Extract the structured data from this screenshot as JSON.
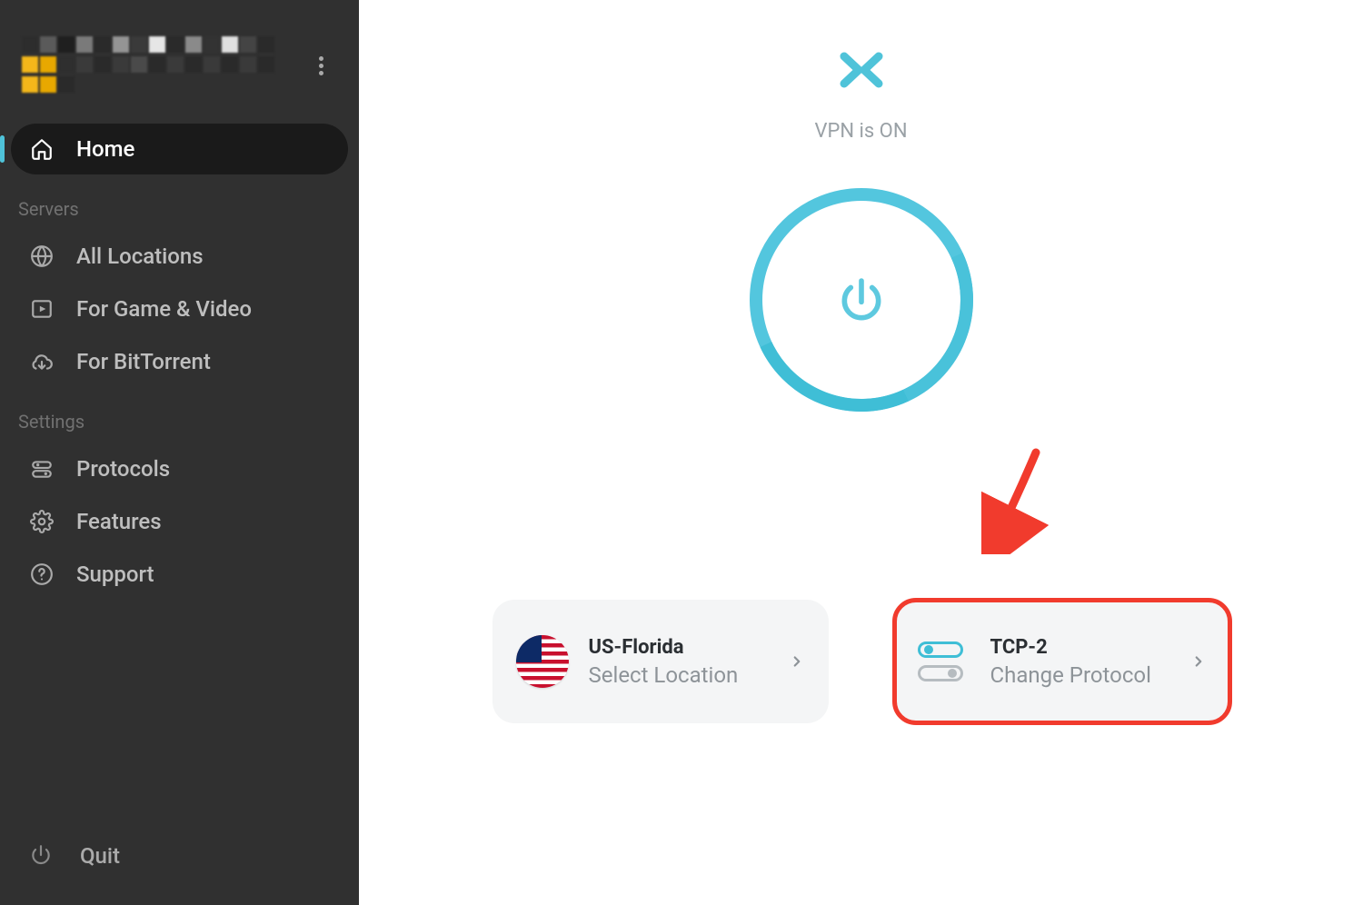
{
  "sidebar": {
    "home_label": "Home",
    "sections": {
      "servers_header": "Servers",
      "settings_header": "Settings"
    },
    "items": {
      "all_locations": "All Locations",
      "game_video": "For Game & Video",
      "bittorrent": "For BitTorrent",
      "protocols": "Protocols",
      "features": "Features",
      "support": "Support"
    },
    "quit_label": "Quit"
  },
  "main": {
    "status": "VPN is ON",
    "location_card": {
      "title": "US-Florida",
      "subtitle": "Select Location"
    },
    "protocol_card": {
      "title": "TCP-2",
      "subtitle": "Change Protocol"
    }
  }
}
